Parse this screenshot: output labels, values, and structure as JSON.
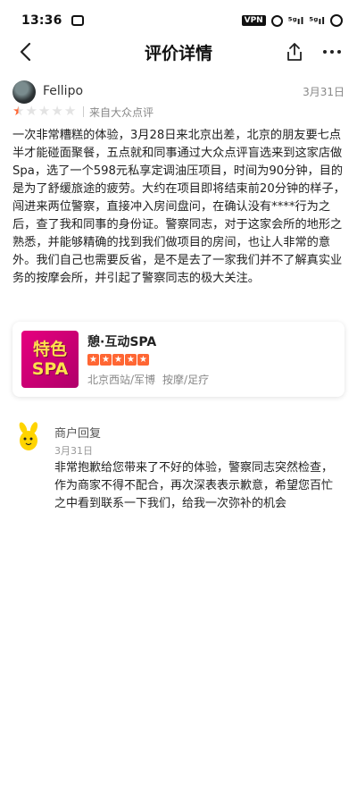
{
  "status_bar": {
    "time": "13:36",
    "vpn": "VPN",
    "signal1": "⁵ᵍıl",
    "signal2": "⁵ᵍıl"
  },
  "header": {
    "title": "评价详情"
  },
  "review": {
    "username": "Fellipo",
    "date": "3月31日",
    "rating_stars": 0.5,
    "source": "来自大众点评",
    "text": "一次非常糟糕的体验，3月28日来北京出差，北京的朋友要七点半才能碰面聚餐，五点就和同事通过大众点评盲选来到这家店做Spa，选了一个598元私享定调油压项目，时间为90分钟，目的是为了舒缓旅途的疲劳。大约在项目即将结束前20分钟的样子，闯进来两位警察，直接冲入房间盘问，在确认没有****行为之后，查了我和同事的身份证。警察同志，对于这家会所的地形之熟悉，并能够精确的找到我们做项目的房间，也让人非常的意外。我们自己也需要反省，是不是去了一家我们并不了解真实业务的按摩会所，并引起了警察同志的极大关注。"
  },
  "shop": {
    "thumb_text": "特色\nSPA",
    "name": "憩·互动SPA",
    "rating_stars": 5,
    "location": "北京西站/军博",
    "category": "按摩/足疗"
  },
  "reply": {
    "title": "商户回复",
    "date": "3月31日",
    "text": "非常抱歉给您带来了不好的体验，警察同志突然检查，作为商家不得不配合，再次深表表示歉意，希望您百忙之中看到联系一下我们，给我一次弥补的机会"
  },
  "colors": {
    "star_active": "#ff6633",
    "star_inactive": "#e3e3e3"
  }
}
